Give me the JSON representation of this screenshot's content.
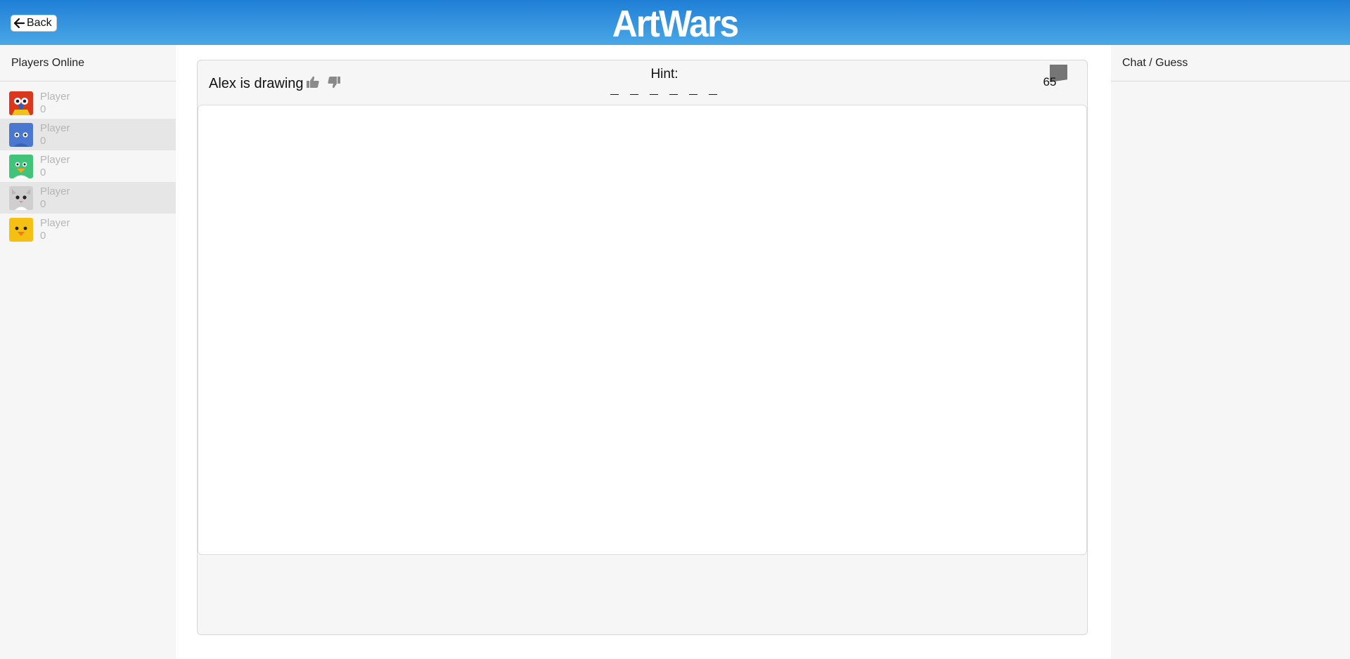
{
  "header": {
    "back_label": "Back",
    "logo_text": "ArtWars",
    "back_icon": "arrow-left-icon"
  },
  "players_panel": {
    "title": "Players Online",
    "players": [
      {
        "name": "Player",
        "score": "0",
        "avatar": "parrot-avatar",
        "color": "#d9381e"
      },
      {
        "name": "Player",
        "score": "0",
        "avatar": "blue-monster-avatar",
        "color": "#4a78d0"
      },
      {
        "name": "Player",
        "score": "0",
        "avatar": "green-bird-avatar",
        "color": "#3fc47a"
      },
      {
        "name": "Player",
        "score": "0",
        "avatar": "gray-cat-avatar",
        "color": "#cfcfcf"
      },
      {
        "name": "Player",
        "score": "0",
        "avatar": "yellow-chick-avatar",
        "color": "#f6c012"
      }
    ]
  },
  "game": {
    "drawer_text": "Alex is drawing",
    "like_icon": "thumbs-up-icon",
    "dislike_icon": "thumbs-down-icon",
    "hint_label": "Hint:",
    "hint_word": "_ _ _ _ _ _",
    "timer_value": "65",
    "timer_color": "#767676"
  },
  "chat_panel": {
    "title": "Chat / Guess"
  },
  "colors": {
    "header_top": "#1f7fd6",
    "header_bottom": "#4aa7e6",
    "panel_bg": "#f6f6f6"
  }
}
